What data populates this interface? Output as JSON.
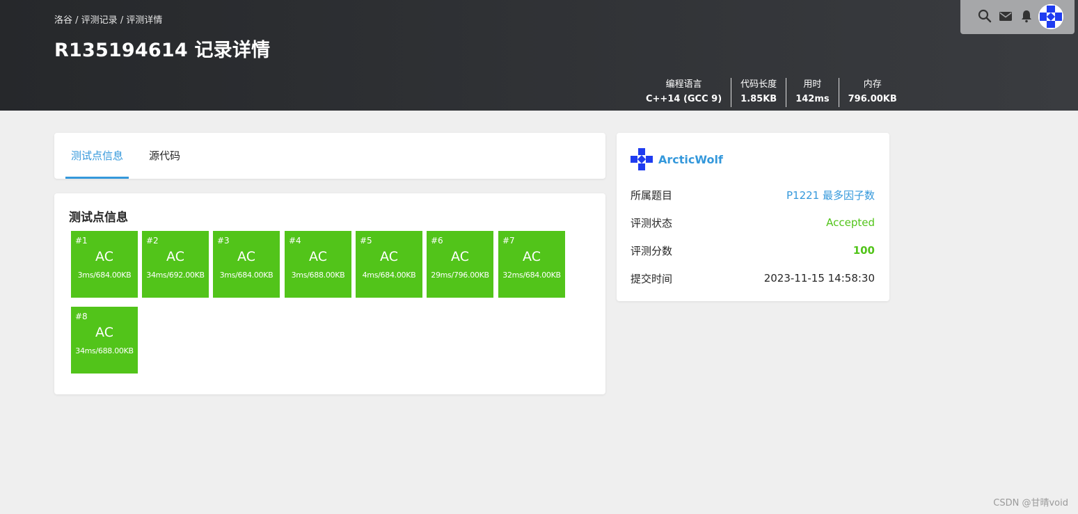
{
  "breadcrumb": [
    "洛谷",
    "评测记录",
    "评测详情"
  ],
  "breadcrumb_separator": " / ",
  "page_title": "R135194614 记录详情",
  "topbar_icons": [
    "search-icon",
    "mail-icon",
    "bell-icon"
  ],
  "stats": [
    {
      "label": "编程语言",
      "value": "C++14 (GCC 9)"
    },
    {
      "label": "代码长度",
      "value": "1.85KB"
    },
    {
      "label": "用时",
      "value": "142ms"
    },
    {
      "label": "内存",
      "value": "796.00KB"
    }
  ],
  "tabs": [
    {
      "label": "测试点信息",
      "active": true
    },
    {
      "label": "源代码",
      "active": false
    }
  ],
  "cases_title": "测试点信息",
  "cases": [
    {
      "num": "#1",
      "status": "AC",
      "info": "3ms/684.00KB"
    },
    {
      "num": "#2",
      "status": "AC",
      "info": "34ms/692.00KB"
    },
    {
      "num": "#3",
      "status": "AC",
      "info": "3ms/684.00KB"
    },
    {
      "num": "#4",
      "status": "AC",
      "info": "3ms/688.00KB"
    },
    {
      "num": "#5",
      "status": "AC",
      "info": "4ms/684.00KB"
    },
    {
      "num": "#6",
      "status": "AC",
      "info": "29ms/796.00KB"
    },
    {
      "num": "#7",
      "status": "AC",
      "info": "32ms/684.00KB"
    },
    {
      "num": "#8",
      "status": "AC",
      "info": "34ms/688.00KB"
    }
  ],
  "user": {
    "name": "ArcticWolf"
  },
  "details": [
    {
      "key": "所属题目",
      "value": "P1221 最多因子数"
    },
    {
      "key": "评测状态",
      "value": "Accepted"
    },
    {
      "key": "评测分数",
      "value": "100"
    },
    {
      "key": "提交时间",
      "value": "2023-11-15 14:58:30"
    }
  ],
  "colors": {
    "accent": "#3498db",
    "ac_green": "#52c41a",
    "header_dark": "#26282b"
  },
  "watermark": "CSDN @甘晴void"
}
